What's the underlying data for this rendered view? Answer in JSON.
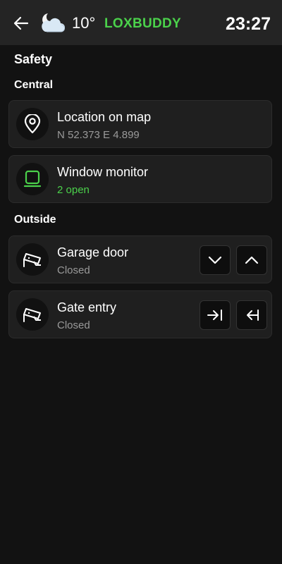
{
  "header": {
    "back_icon": "arrow-left-icon",
    "weather_icon": "moon-cloud-icon",
    "temperature": "10°",
    "brand": "LOXBUDDY",
    "time": "23:27",
    "colors": {
      "brand": "#4bd14b",
      "header_bg": "#242424"
    }
  },
  "page": {
    "title": "Safety"
  },
  "groups": [
    {
      "title": "Central",
      "items": [
        {
          "icon": "map-pin-icon",
          "title": "Location on map",
          "subtitle": "N 52.373 E 4.899"
        },
        {
          "icon": "window-monitor-icon",
          "title": "Window monitor",
          "subtitle": "2 open",
          "subtitle_color": "#4bd14b"
        }
      ]
    },
    {
      "title": "Outside",
      "items": [
        {
          "icon": "security-camera-icon",
          "title": "Garage door",
          "subtitle": "Closed",
          "actions": [
            "chevron-down-icon",
            "chevron-up-icon"
          ]
        },
        {
          "icon": "security-camera-icon",
          "title": "Gate entry",
          "subtitle": "Closed",
          "actions": [
            "arrow-right-to-bar-icon",
            "arrow-left-to-bar-icon"
          ]
        }
      ]
    }
  ],
  "colors": {
    "background": "#121212",
    "card": "#1f1f1f",
    "muted_text": "#9a9a9a",
    "accent": "#4bd14b"
  }
}
